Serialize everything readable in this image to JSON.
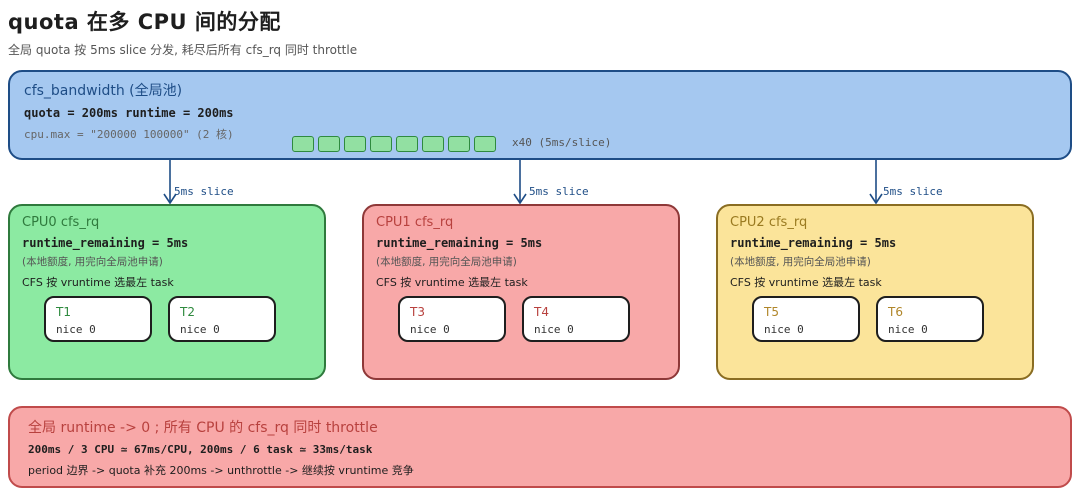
{
  "title": "quota 在多 CPU 间的分配",
  "subtitle": "全局 quota 按 5ms slice 分发, 耗尽后所有 cfs_rq 同时 throttle",
  "pool": {
    "title": "cfs_bandwidth (全局池)",
    "quota_line": "quota = 200ms  runtime = 200ms",
    "cpu_max": "cpu.max = \"200000 100000\"  (2 核)",
    "slice_count_label": "x40  (5ms/slice)"
  },
  "arrow_label": "5ms slice",
  "cpus": [
    {
      "title": "CPU0 cfs_rq",
      "remaining": "runtime_remaining = 5ms",
      "note": "(本地额度, 用完向全局池申请)",
      "cfs": "CFS 按 vruntime 选最左 task",
      "tasks": [
        {
          "name": "T1",
          "nice": "nice 0"
        },
        {
          "name": "T2",
          "nice": "nice 0"
        }
      ]
    },
    {
      "title": "CPU1 cfs_rq",
      "remaining": "runtime_remaining = 5ms",
      "note": "(本地额度, 用完向全局池申请)",
      "cfs": "CFS 按 vruntime 选最左 task",
      "tasks": [
        {
          "name": "T3",
          "nice": "nice 0"
        },
        {
          "name": "T4",
          "nice": "nice 0"
        }
      ]
    },
    {
      "title": "CPU2 cfs_rq",
      "remaining": "runtime_remaining = 5ms",
      "note": "(本地额度, 用完向全局池申请)",
      "cfs": "CFS 按 vruntime 选最左 task",
      "tasks": [
        {
          "name": "T5",
          "nice": "nice 0"
        },
        {
          "name": "T6",
          "nice": "nice 0"
        }
      ]
    }
  ],
  "bottom": {
    "title": "全局 runtime -> 0 ; 所有 CPU 的 cfs_rq 同时 throttle",
    "calc": "200ms / 3 CPU ≃ 67ms/CPU,  200ms / 6 task ≃ 33ms/task",
    "period": "period 边界 -> quota 补充 200ms -> unthrottle -> 继续按 vruntime 竞争"
  },
  "colors": {
    "pool": "#a5c8f0",
    "cpu0": "#8ceaa2",
    "cpu1": "#f8a8a8",
    "cpu2": "#fbe49a",
    "throttle": "#f8a8a8",
    "arrow": "#1e4d86"
  }
}
